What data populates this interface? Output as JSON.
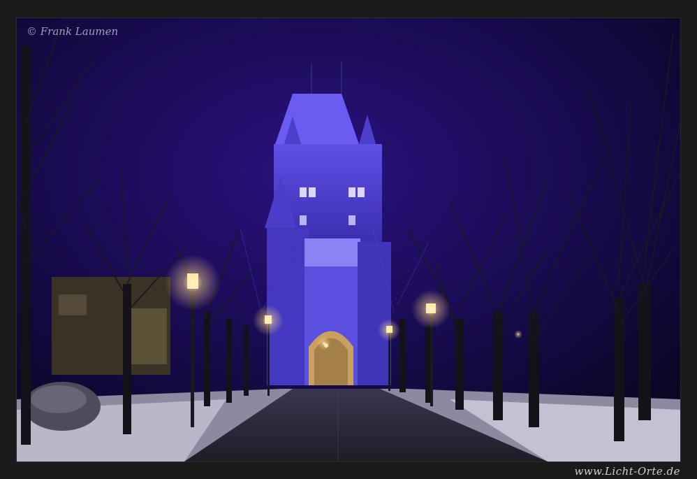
{
  "photo": {
    "copyright": "© Frank Laumen",
    "website": "www.Licht-Orte.de"
  },
  "colors": {
    "sky": "#1c0d55",
    "tower_light": "#5a4ad8",
    "lamp": "#ffe9a8",
    "snow": "#d8d8e6",
    "road": "#2a2833"
  }
}
